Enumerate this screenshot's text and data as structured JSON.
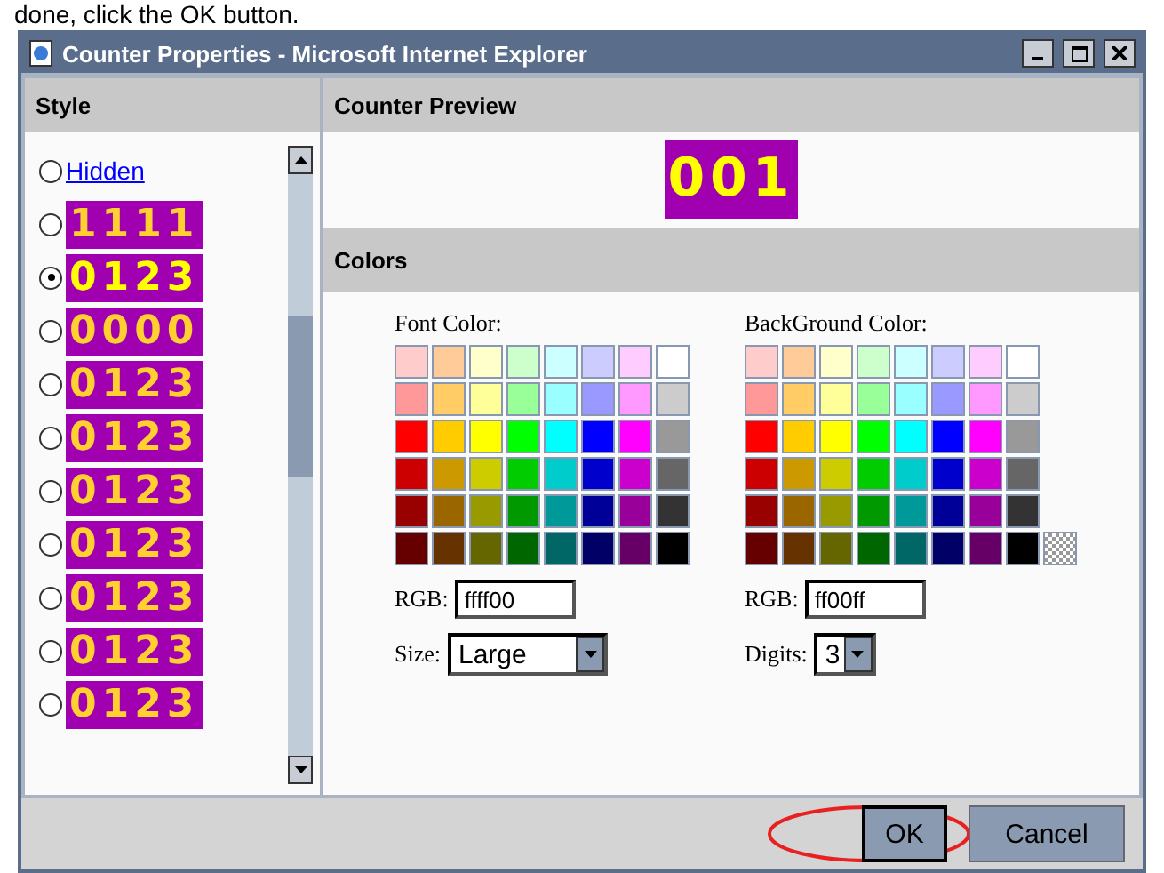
{
  "caption": "done, click the OK button.",
  "window": {
    "title": "Counter Properties - Microsoft Internet Explorer"
  },
  "style_panel": {
    "header": "Style",
    "items": [
      {
        "kind": "link",
        "label": "Hidden",
        "selected": false
      },
      {
        "kind": "counter",
        "digits": "1111",
        "selected": false
      },
      {
        "kind": "counter",
        "digits": "0123",
        "selected": true
      },
      {
        "kind": "counter",
        "digits": "0000",
        "selected": false
      },
      {
        "kind": "counter",
        "digits": "0123",
        "selected": false
      },
      {
        "kind": "counter",
        "digits": "0123",
        "selected": false
      },
      {
        "kind": "counter",
        "digits": "0123",
        "selected": false
      },
      {
        "kind": "counter",
        "digits": "0123",
        "selected": false
      },
      {
        "kind": "counter",
        "digits": "0123",
        "selected": false
      },
      {
        "kind": "counter",
        "digits": "0123",
        "selected": false
      },
      {
        "kind": "counter",
        "digits": "0123",
        "selected": false
      }
    ]
  },
  "preview": {
    "header": "Counter Preview",
    "digits": "001"
  },
  "colors": {
    "header": "Colors",
    "palette": [
      [
        {
          "color": "#ffcccc"
        },
        {
          "color": "#ffcc99"
        },
        {
          "color": "#ffffcc"
        },
        {
          "color": "#ccffcc"
        },
        {
          "color": "#ccffff"
        },
        {
          "color": "#ccccff"
        },
        {
          "color": "#ffccff"
        },
        {
          "color": "#ffffff"
        }
      ],
      [
        {
          "color": "#ff9999"
        },
        {
          "color": "#ffcc66"
        },
        {
          "color": "#ffff99"
        },
        {
          "color": "#99ff99"
        },
        {
          "color": "#99ffff"
        },
        {
          "color": "#9999ff"
        },
        {
          "color": "#ff99ff"
        },
        {
          "color": "#cccccc"
        }
      ],
      [
        {
          "color": "#ff0000"
        },
        {
          "color": "#ffcc00"
        },
        {
          "color": "#ffff00"
        },
        {
          "color": "#00ff00"
        },
        {
          "color": "#00ffff"
        },
        {
          "color": "#0000ff"
        },
        {
          "color": "#ff00ff"
        },
        {
          "color": "#999999"
        }
      ],
      [
        {
          "color": "#cc0000"
        },
        {
          "color": "#cc9900"
        },
        {
          "color": "#cccc00"
        },
        {
          "color": "#00cc00"
        },
        {
          "color": "#00cccc"
        },
        {
          "color": "#0000cc"
        },
        {
          "color": "#cc00cc"
        },
        {
          "color": "#666666"
        }
      ],
      [
        {
          "color": "#990000"
        },
        {
          "color": "#996600"
        },
        {
          "color": "#999900"
        },
        {
          "color": "#009900"
        },
        {
          "color": "#009999"
        },
        {
          "color": "#000099"
        },
        {
          "color": "#990099"
        },
        {
          "color": "#333333"
        }
      ],
      [
        {
          "color": "#660000"
        },
        {
          "color": "#663300"
        },
        {
          "color": "#666600"
        },
        {
          "color": "#006600"
        },
        {
          "color": "#006666"
        },
        {
          "color": "#000066"
        },
        {
          "color": "#660066"
        },
        {
          "color": "#000000"
        }
      ]
    ],
    "font_color": {
      "label": "Font Color:",
      "rgb_label": "RGB:",
      "rgb": "ffff00"
    },
    "background_color": {
      "label": "BackGround Color:",
      "rgb_label": "RGB:",
      "rgb": "ff00ff",
      "transparent_option": true
    },
    "size": {
      "label": "Size:",
      "value": "Large"
    },
    "digits": {
      "label": "Digits:",
      "value": "3"
    }
  },
  "buttons": [
    {
      "label": "OK",
      "highlighted": true
    },
    {
      "label": "Cancel",
      "highlighted": false
    }
  ]
}
